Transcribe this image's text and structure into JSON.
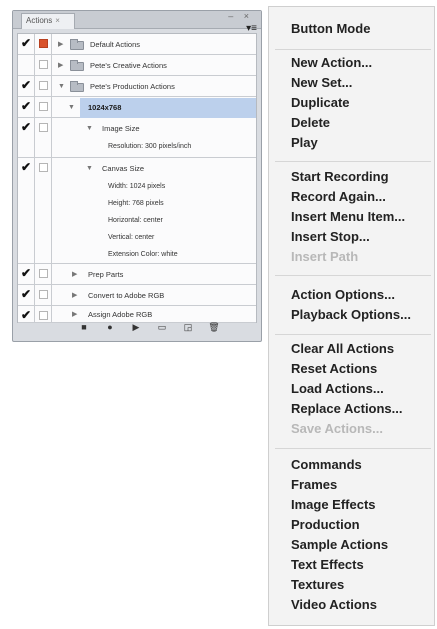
{
  "panel": {
    "tab_label": "Actions",
    "tab_close": "×",
    "window_controls": "– ×",
    "menu_button": "▾≡",
    "rows": [
      {
        "checked": "✔",
        "dialog": "red",
        "expanded": false,
        "folder": true,
        "label": "Default Actions"
      },
      {
        "checked": "",
        "dialog": "empty",
        "expanded": false,
        "folder": true,
        "label": "Pete's Creative Actions"
      },
      {
        "checked": "✔",
        "dialog": "empty",
        "expanded": true,
        "folder": true,
        "label": "Pete's Production Actions"
      },
      {
        "checked": "✔",
        "dialog": "empty",
        "expanded": true,
        "folder": false,
        "label": "1024x768",
        "selected": true
      },
      {
        "checked": "✔",
        "dialog": "empty",
        "expanded": true,
        "label": "Image Size",
        "details": [
          "Resolution: 300 pixels/inch"
        ]
      },
      {
        "checked": "✔",
        "dialog": "empty",
        "expanded": true,
        "label": "Canvas Size",
        "details": [
          "Width: 1024 pixels",
          "Height: 768 pixels",
          "Horizontal: center",
          "Vertical: center",
          "Extension Color: white"
        ]
      },
      {
        "checked": "✔",
        "dialog": "empty",
        "expanded": false,
        "label": "Prep Parts"
      },
      {
        "checked": "✔",
        "dialog": "empty",
        "expanded": false,
        "label": "Convert to Adobe RGB"
      },
      {
        "checked": "✔",
        "dialog": "empty",
        "expanded": false,
        "label": "Assign Adobe RGB"
      }
    ],
    "bottom_buttons": [
      "■",
      "●",
      "▶",
      "▭",
      "◲",
      "🗑"
    ]
  },
  "menu": {
    "groups": [
      {
        "items": [
          {
            "label": "Button Mode",
            "enabled": true
          }
        ]
      },
      {
        "items": [
          {
            "label": "New Action...",
            "enabled": true
          },
          {
            "label": "New Set...",
            "enabled": true
          },
          {
            "label": "Duplicate",
            "enabled": true
          },
          {
            "label": "Delete",
            "enabled": true
          },
          {
            "label": "Play",
            "enabled": true
          }
        ]
      },
      {
        "items": [
          {
            "label": "Start Recording",
            "enabled": true
          },
          {
            "label": "Record Again...",
            "enabled": true
          },
          {
            "label": "Insert Menu Item...",
            "enabled": true
          },
          {
            "label": "Insert Stop...",
            "enabled": true
          },
          {
            "label": "Insert Path",
            "enabled": false
          }
        ]
      },
      {
        "items": [
          {
            "label": "Action Options...",
            "enabled": true
          },
          {
            "label": "Playback Options...",
            "enabled": true
          }
        ]
      },
      {
        "items": [
          {
            "label": "Clear All Actions",
            "enabled": true
          },
          {
            "label": "Reset Actions",
            "enabled": true
          },
          {
            "label": "Load Actions...",
            "enabled": true
          },
          {
            "label": "Replace Actions...",
            "enabled": true
          },
          {
            "label": "Save Actions...",
            "enabled": false
          }
        ]
      },
      {
        "items": [
          {
            "label": "Commands",
            "enabled": true
          },
          {
            "label": "Frames",
            "enabled": true
          },
          {
            "label": "Image Effects",
            "enabled": true
          },
          {
            "label": "Production",
            "enabled": true
          },
          {
            "label": "Sample Actions",
            "enabled": true
          },
          {
            "label": "Text Effects",
            "enabled": true
          },
          {
            "label": "Textures",
            "enabled": true
          },
          {
            "label": "Video Actions",
            "enabled": true
          }
        ]
      }
    ]
  }
}
